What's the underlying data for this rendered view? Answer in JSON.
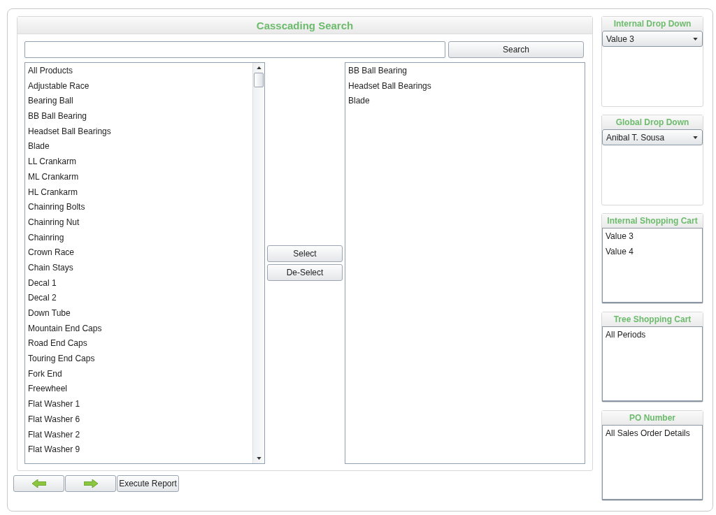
{
  "main": {
    "title": "Casscading Search",
    "search_button": "Search",
    "available": [
      "All Products",
      "Adjustable Race",
      "Bearing Ball",
      "BB Ball Bearing",
      "Headset Ball Bearings",
      "Blade",
      "LL Crankarm",
      "ML Crankarm",
      "HL Crankarm",
      "Chainring Bolts",
      "Chainring Nut",
      "Chainring",
      "Crown Race",
      "Chain Stays",
      "Decal 1",
      "Decal 2",
      "Down Tube",
      "Mountain End Caps",
      "Road End Caps",
      "Touring End Caps",
      "Fork End",
      "Freewheel",
      "Flat Washer 1",
      "Flat Washer 6",
      "Flat Washer 2",
      "Flat Washer 9"
    ],
    "select_button": "Select",
    "deselect_button": "De-Select",
    "selected": [
      "BB Ball Bearing",
      "Headset Ball Bearings",
      "Blade"
    ]
  },
  "side_panels": [
    {
      "title": "Internal Drop Down",
      "kind": "dropdown",
      "value": "Value 3"
    },
    {
      "title": "Global Drop Down",
      "kind": "dropdown",
      "value": "Anibal T. Sousa"
    },
    {
      "title": "Internal Shopping Cart",
      "kind": "list",
      "items": [
        "Value 3",
        "Value 4"
      ]
    },
    {
      "title": "Tree Shopping Cart",
      "kind": "list",
      "items": [
        "All Periods"
      ]
    },
    {
      "title": "PO Number",
      "kind": "list",
      "items": [
        "All Sales Order Details"
      ]
    }
  ],
  "footer": {
    "execute_button": "Execute Report"
  }
}
